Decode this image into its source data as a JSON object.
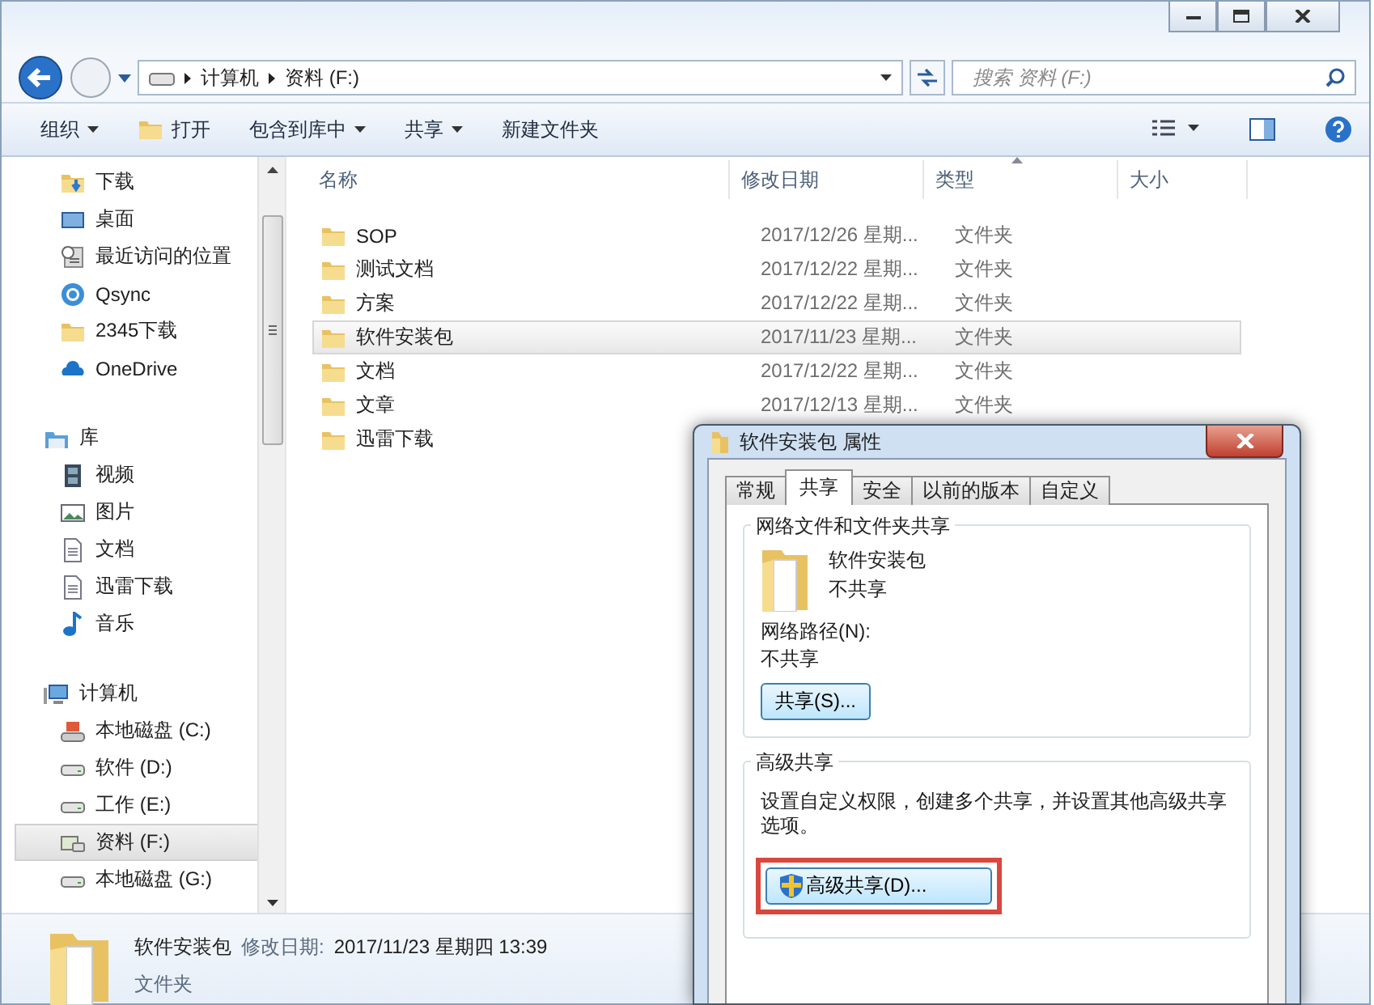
{
  "address": {
    "path": [
      "计算机",
      "资料 (F:)"
    ],
    "search_placeholder": "搜索 资料 (F:)"
  },
  "toolbar": [
    {
      "label": "组织",
      "kind": "dropdown"
    },
    {
      "label": "打开",
      "kind": "open"
    },
    {
      "label": "包含到库中",
      "kind": "dropdown"
    },
    {
      "label": "共享",
      "kind": "dropdown"
    },
    {
      "label": "新建文件夹",
      "kind": "plain"
    }
  ],
  "navigation": [
    {
      "label": "下载",
      "kind": "download",
      "selected": false
    },
    {
      "label": "桌面",
      "kind": "desktop",
      "selected": false
    },
    {
      "label": "最近访问的位置",
      "kind": "recent",
      "selected": false
    },
    {
      "label": "Qsync",
      "kind": "sync",
      "selected": false
    },
    {
      "label": "2345下载",
      "kind": "folder",
      "selected": false
    },
    {
      "label": "OneDrive",
      "kind": "cloud",
      "selected": false
    },
    {
      "label": "库",
      "kind": "library",
      "selected": false,
      "children": [
        {
          "label": "视频",
          "kind": "video",
          "selected": false
        },
        {
          "label": "图片",
          "kind": "picture",
          "selected": false
        },
        {
          "label": "文档",
          "kind": "document",
          "selected": false
        },
        {
          "label": "迅雷下载",
          "kind": "document",
          "selected": false
        },
        {
          "label": "音乐",
          "kind": "music",
          "selected": false
        }
      ]
    },
    {
      "label": "计算机",
      "kind": "computer",
      "selected": false,
      "children": [
        {
          "label": "本地磁盘 (C:)",
          "kind": "system-drive",
          "selected": false
        },
        {
          "label": "软件 (D:)",
          "kind": "drive",
          "selected": false
        },
        {
          "label": "工作 (E:)",
          "kind": "drive",
          "selected": false
        },
        {
          "label": "资料 (F:)",
          "kind": "media-drive",
          "selected": true
        },
        {
          "label": "本地磁盘 (G:)",
          "kind": "drive",
          "selected": false
        }
      ]
    }
  ],
  "table": {
    "columns": [
      {
        "label": "名称",
        "sorted": false
      },
      {
        "label": "修改日期",
        "sorted": false
      },
      {
        "label": "类型",
        "sorted": true
      },
      {
        "label": "大小",
        "sorted": false
      }
    ],
    "rows": [
      {
        "name": "SOP",
        "date": "2017/12/26 星期...",
        "type": "文件夹",
        "selected": false
      },
      {
        "name": "测试文档",
        "date": "2017/12/22 星期...",
        "type": "文件夹",
        "selected": false
      },
      {
        "name": "方案",
        "date": "2017/12/22 星期...",
        "type": "文件夹",
        "selected": false
      },
      {
        "name": "软件安装包",
        "date": "2017/11/23 星期...",
        "type": "文件夹",
        "selected": true
      },
      {
        "name": "文档",
        "date": "2017/12/22 星期...",
        "type": "文件夹",
        "selected": false
      },
      {
        "name": "文章",
        "date": "2017/12/13 星期...",
        "type": "文件夹",
        "selected": false
      },
      {
        "name": "迅雷下载",
        "selected": false
      }
    ]
  },
  "details": {
    "name": "软件安装包",
    "date_label": "修改日期:",
    "date": "2017/11/23 星期四 13:39",
    "type": "文件夹"
  },
  "dialog": {
    "title": "软件安装包 属性",
    "tabs": [
      {
        "label": "常规",
        "selected": false
      },
      {
        "label": "共享",
        "selected": true
      },
      {
        "label": "安全",
        "selected": false
      },
      {
        "label": "以前的版本",
        "selected": false
      },
      {
        "label": "自定义",
        "selected": false
      }
    ],
    "network_group": {
      "title": "网络文件和文件夹共享",
      "item_name": "软件安装包",
      "item_status": "不共享",
      "path_label": "网络路径(N):",
      "path_value": "不共享",
      "button": "共享(S)..."
    },
    "advanced_group": {
      "title": "高级共享",
      "description": "设置自定义权限，创建多个共享，并设置其他高级共享选项。",
      "button": "高级共享(D)...",
      "highlighted": true
    }
  }
}
